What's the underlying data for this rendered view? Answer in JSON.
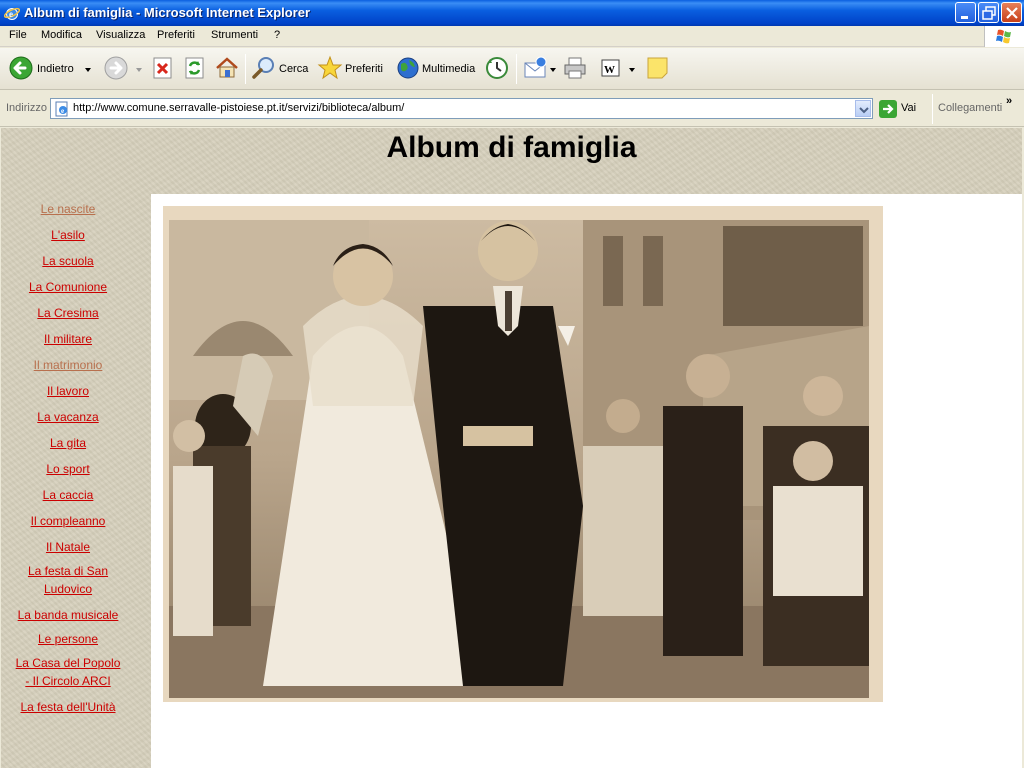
{
  "window": {
    "title": "Album di famiglia - Microsoft Internet Explorer"
  },
  "menu": [
    "File",
    "Modifica",
    "Visualizza",
    "Preferiti",
    "Strumenti",
    "?"
  ],
  "toolbar": {
    "back_label": "Indietro",
    "search_label": "Cerca",
    "favorites_label": "Preferiti",
    "media_label": "Multimedia"
  },
  "address": {
    "label": "Indirizzo",
    "url": "http://www.comune.serravalle-pistoiese.pt.it/servizi/biblioteca/album/",
    "go_label": "Vai",
    "links_label": "Collegamenti",
    "chevron": "»"
  },
  "page": {
    "title": "Album di famiglia",
    "nav": [
      {
        "label": "Le nascite",
        "visited": true
      },
      {
        "label": "L'asilo",
        "visited": false
      },
      {
        "label": "La scuola",
        "visited": false
      },
      {
        "label": "La Comunione",
        "visited": false
      },
      {
        "label": "La Cresima",
        "visited": false
      },
      {
        "label": "Il militare",
        "visited": false
      },
      {
        "label": "Il matrimonio",
        "visited": true
      },
      {
        "label": "Il lavoro",
        "visited": false
      },
      {
        "label": "La vacanza",
        "visited": false
      },
      {
        "label": "La gita",
        "visited": false
      },
      {
        "label": "Lo sport",
        "visited": false
      },
      {
        "label": "La caccia",
        "visited": false
      },
      {
        "label": "Il compleanno",
        "visited": false
      },
      {
        "label": "Il Natale",
        "visited": false
      },
      {
        "label": "La festa di San Ludovico",
        "visited": false
      },
      {
        "label": "La banda musicale",
        "visited": false
      },
      {
        "label": "Le persone",
        "visited": false
      },
      {
        "label": "La Casa del Popolo - Il Circolo ARCI",
        "visited": false
      },
      {
        "label": "La festa dell'Unità",
        "visited": false
      }
    ],
    "photo": {
      "icon": "wedding-photo"
    }
  },
  "colors": {
    "link": "#CC0000",
    "visited_link": "#B8704E",
    "titlebar": "#0A5FE0",
    "page_bg": "#D6D0BC"
  }
}
